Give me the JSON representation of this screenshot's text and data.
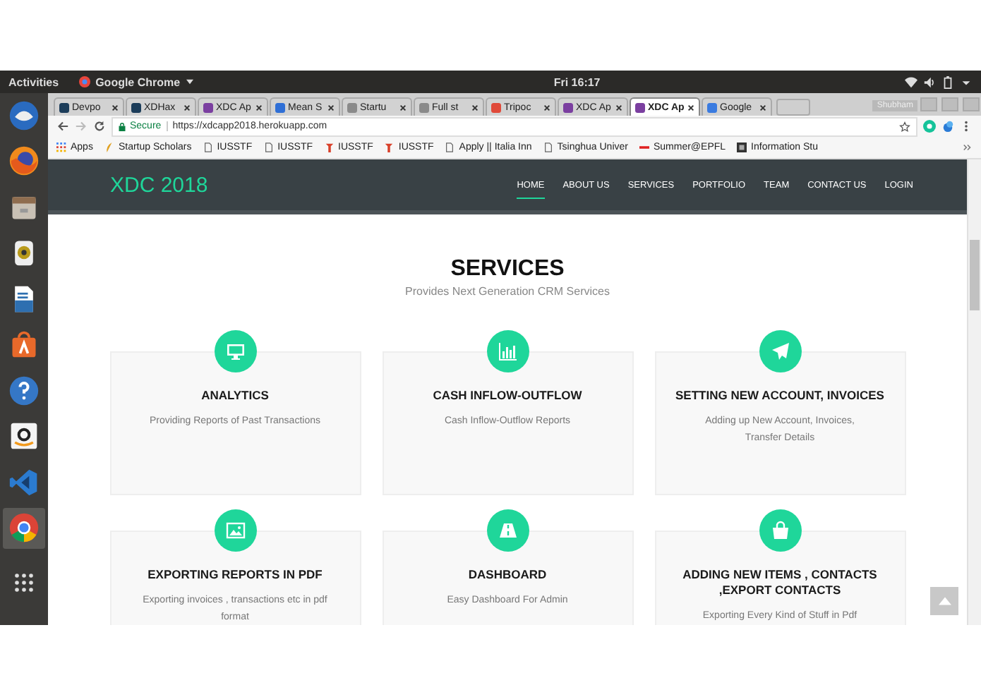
{
  "top_bar": {
    "activities": "Activities",
    "app_menu": "Google Chrome",
    "clock": "Fri 16:17"
  },
  "dock": [
    {
      "kind": "mail"
    },
    {
      "kind": "browser"
    },
    {
      "kind": "files"
    },
    {
      "kind": "music"
    },
    {
      "kind": "document"
    },
    {
      "kind": "store"
    },
    {
      "kind": "help"
    },
    {
      "kind": "shop"
    },
    {
      "kind": "code"
    },
    {
      "kind": "chrome",
      "selected": true
    }
  ],
  "tabs": [
    {
      "label": "Devpo",
      "color": "#1c3d5a",
      "selected": false
    },
    {
      "label": "XDHax",
      "color": "#1c3d5a",
      "selected": false
    },
    {
      "label": "XDC Ap",
      "color": "#7b3fa0",
      "selected": false
    },
    {
      "label": "Mean S",
      "color": "#2f6fd6",
      "selected": false
    },
    {
      "label": "Startu",
      "color": "#8a8a8a",
      "selected": false
    },
    {
      "label": "Full st",
      "color": "#8a8a8a",
      "selected": false
    },
    {
      "label": "Tripoc",
      "color": "#e04a3a",
      "selected": false
    },
    {
      "label": "XDC Ap",
      "color": "#7b3fa0",
      "selected": false
    },
    {
      "label": "XDC Ap",
      "color": "#7b3fa0",
      "selected": true
    },
    {
      "label": "Google",
      "color": "#3a7be0",
      "selected": false
    }
  ],
  "profile": "Shubham",
  "address_bar": {
    "secure": "Secure",
    "url": "https://xdcapp2018.herokuapp.com"
  },
  "bookmarks": [
    {
      "label": "Apps",
      "kind": "apps"
    },
    {
      "label": "Startup Scholars",
      "kind": "feather"
    },
    {
      "label": "IUSSTF",
      "kind": "page"
    },
    {
      "label": "IUSSTF",
      "kind": "page"
    },
    {
      "label": "IUSSTF",
      "kind": "logo"
    },
    {
      "label": "IUSSTF",
      "kind": "logo"
    },
    {
      "label": "Apply || Italia Inn",
      "kind": "page"
    },
    {
      "label": "Tsinghua Univer",
      "kind": "page"
    },
    {
      "label": "Summer@EPFL",
      "kind": "flag"
    },
    {
      "label": "Information Stu",
      "kind": "dark"
    }
  ],
  "site": {
    "brand": "XDC 2018",
    "nav": [
      {
        "label": "HOME",
        "selected": true
      },
      {
        "label": "ABOUT US",
        "selected": false
      },
      {
        "label": "SERVICES",
        "selected": false
      },
      {
        "label": "PORTFOLIO",
        "selected": false
      },
      {
        "label": "TEAM",
        "selected": false
      },
      {
        "label": "CONTACT US",
        "selected": false
      },
      {
        "label": "LOGIN",
        "selected": false
      }
    ],
    "title": "SERVICES",
    "subtitle": "Provides Next Generation CRM Services",
    "services": [
      {
        "kind": "monitor",
        "title": "ANALYTICS",
        "text": "Providing Reports of Past Transactions"
      },
      {
        "kind": "chart",
        "title": "CASH INFLOW-OUTFLOW",
        "text": "Cash Inflow-Outflow Reports"
      },
      {
        "kind": "plane",
        "title": "SETTING NEW ACCOUNT, INVOICES",
        "text": "Adding up New Account, Invoices, Transfer Details"
      },
      {
        "kind": "image",
        "title": "EXPORTING REPORTS IN PDF",
        "text": "Exporting invoices , transactions etc in pdf format"
      },
      {
        "kind": "road",
        "title": "DASHBOARD",
        "text": "Easy Dashboard For Admin"
      },
      {
        "kind": "bag",
        "title": "ADDING NEW ITEMS , CONTACTS ,EXPORT CONTACTS",
        "text": "Exporting Every Kind of Stuff in Pdf"
      }
    ]
  }
}
